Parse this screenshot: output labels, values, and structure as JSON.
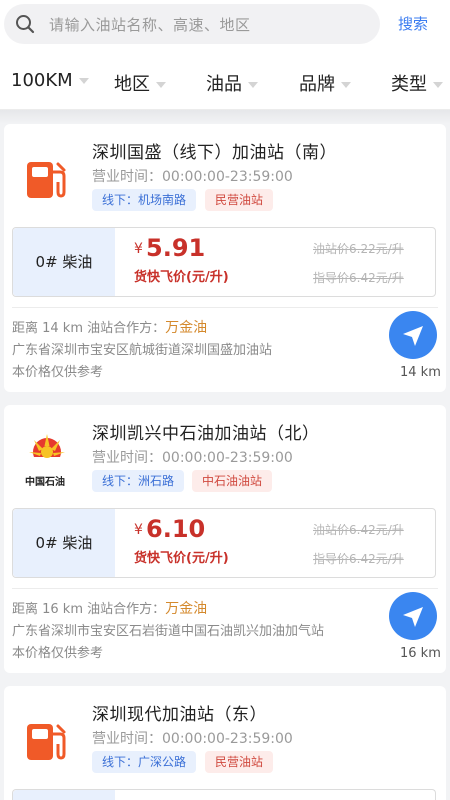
{
  "search": {
    "placeholder": "请输入油站名称、高速、地区",
    "button": "搜索"
  },
  "filters": [
    {
      "label": "100KM"
    },
    {
      "label": "地区"
    },
    {
      "label": "油品"
    },
    {
      "label": "品牌"
    },
    {
      "label": "类型"
    }
  ],
  "stations": [
    {
      "name": "深圳国盛（线下）加油站（南）",
      "logo": "fuel-pump-icon",
      "hours": "营业时间：00:00:00-23:59:00",
      "tag1": "线下：机场南路",
      "tag2": "民营油站",
      "fuel": "0# 柴油",
      "currency": "¥",
      "price": "5.91",
      "price_label": "货快飞价(元/升)",
      "station_price": "油站价6.22元/升",
      "guide_price": "指导价6.42元/升",
      "distance_line": "距离 14 km  油站合作方：",
      "partner": "万金油",
      "address": "广东省深圳市宝安区航城街道深圳国盛加油站",
      "note": "本价格仅供参考",
      "km": "14 km"
    },
    {
      "name": "深圳凯兴中石油加油站（北）",
      "logo": "petrochina-logo",
      "logo_text": "中国石油",
      "hours": "营业时间：00:00:00-23:59:00",
      "tag1": "线下：洲石路",
      "tag2": "中石油油站",
      "fuel": "0# 柴油",
      "currency": "¥",
      "price": "6.10",
      "price_label": "货快飞价(元/升)",
      "station_price": "油站价6.42元/升",
      "guide_price": "指导价6.42元/升",
      "distance_line": "距离 16 km  油站合作方：",
      "partner": "万金油",
      "address": "广东省深圳市宝安区石岩街道中国石油凯兴加油加气站",
      "note": "本价格仅供参考",
      "km": "16 km"
    },
    {
      "name": "深圳现代加油站（东）",
      "logo": "fuel-pump-icon",
      "hours": "营业时间：00:00:00-23:59:00",
      "tag1": "线下：广深公路",
      "tag2": "民营油站"
    }
  ],
  "colors": {
    "accent": "#3a86f0",
    "price": "#c8312a",
    "partner": "#d4892c"
  }
}
